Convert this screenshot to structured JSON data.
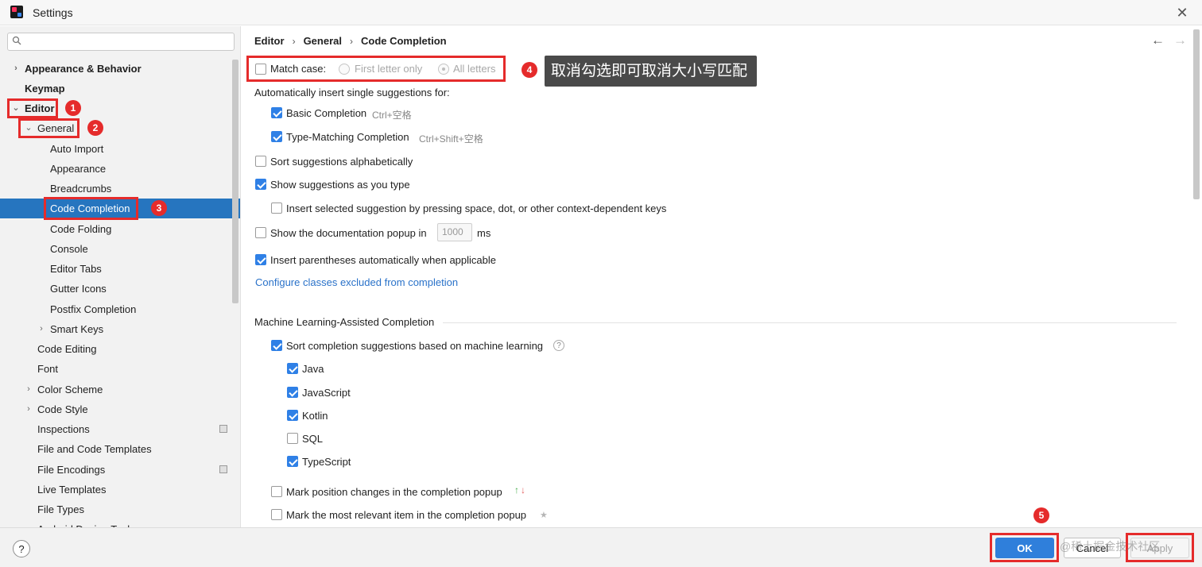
{
  "window": {
    "title": "Settings"
  },
  "search": {
    "placeholder": ""
  },
  "tree": [
    {
      "label": "Appearance & Behavior",
      "chevron": "›"
    },
    {
      "label": "Keymap"
    },
    {
      "label": "Editor",
      "chevron": "⌄"
    },
    {
      "label": "General",
      "chevron": "⌄"
    },
    {
      "label": "Auto Import"
    },
    {
      "label": "Appearance"
    },
    {
      "label": "Breadcrumbs"
    },
    {
      "label": "Code Completion"
    },
    {
      "label": "Code Folding"
    },
    {
      "label": "Console"
    },
    {
      "label": "Editor Tabs"
    },
    {
      "label": "Gutter Icons"
    },
    {
      "label": "Postfix Completion"
    },
    {
      "label": "Smart Keys",
      "chevron": "›"
    },
    {
      "label": "Code Editing"
    },
    {
      "label": "Font"
    },
    {
      "label": "Color Scheme",
      "chevron": "›"
    },
    {
      "label": "Code Style",
      "chevron": "›"
    },
    {
      "label": "Inspections"
    },
    {
      "label": "File and Code Templates"
    },
    {
      "label": "File Encodings"
    },
    {
      "label": "Live Templates"
    },
    {
      "label": "File Types"
    },
    {
      "label": "Android Design Tools"
    }
  ],
  "breadcrumb": {
    "items": [
      "Editor",
      "General",
      "Code Completion"
    ],
    "separator": "›"
  },
  "nav": {
    "back": "←",
    "forward": "→"
  },
  "settings": {
    "match_case": {
      "label": "Match case:",
      "checked": false,
      "option_first": "First letter only",
      "option_all": "All letters"
    },
    "auto_insert_header": "Automatically insert single suggestions for:",
    "basic_completion": {
      "label": "Basic Completion",
      "shortcut": "Ctrl+空格",
      "checked": true
    },
    "type_matching": {
      "label": "Type-Matching Completion",
      "shortcut": "Ctrl+Shift+空格",
      "checked": true
    },
    "sort_alpha": {
      "label": "Sort suggestions alphabetically",
      "checked": false
    },
    "show_as_type": {
      "label": "Show suggestions as you type",
      "checked": true
    },
    "insert_selected": {
      "label": "Insert selected suggestion by pressing space, dot, or other context-dependent keys",
      "checked": false
    },
    "show_doc": {
      "label": "Show the documentation popup in",
      "value": "1000",
      "unit": "ms",
      "checked": false
    },
    "insert_parens": {
      "label": "Insert parentheses automatically when applicable",
      "checked": true
    },
    "configure_link": "Configure classes excluded from completion",
    "ml_header": "Machine Learning-Assisted Completion",
    "ml_sort": {
      "label": "Sort completion suggestions based on machine learning",
      "checked": true
    },
    "ml_help": "?",
    "languages": [
      {
        "label": "Java",
        "checked": true
      },
      {
        "label": "JavaScript",
        "checked": true
      },
      {
        "label": "Kotlin",
        "checked": true
      },
      {
        "label": "SQL",
        "checked": false
      },
      {
        "label": "TypeScript",
        "checked": true
      }
    ],
    "mark_position": {
      "label": "Mark position changes in the completion popup",
      "checked": false,
      "icon_up": "↑",
      "icon_down": "↓"
    },
    "mark_relevant": {
      "label": "Mark the most relevant item in the completion popup",
      "checked": false,
      "icon": "★"
    }
  },
  "annotations": {
    "tooltip": "取消勾选即可取消大小写匹配",
    "steps": [
      "1",
      "2",
      "3",
      "4",
      "5"
    ],
    "color": "#e52b2b"
  },
  "footer": {
    "help": "?",
    "ok": "OK",
    "cancel": "Cancel",
    "apply": "Apply",
    "watermark": "@稀土掘金技术社区"
  },
  "colors": {
    "accent": "#2f7fdb",
    "selection": "#2675bf",
    "link": "#2a72c9"
  }
}
